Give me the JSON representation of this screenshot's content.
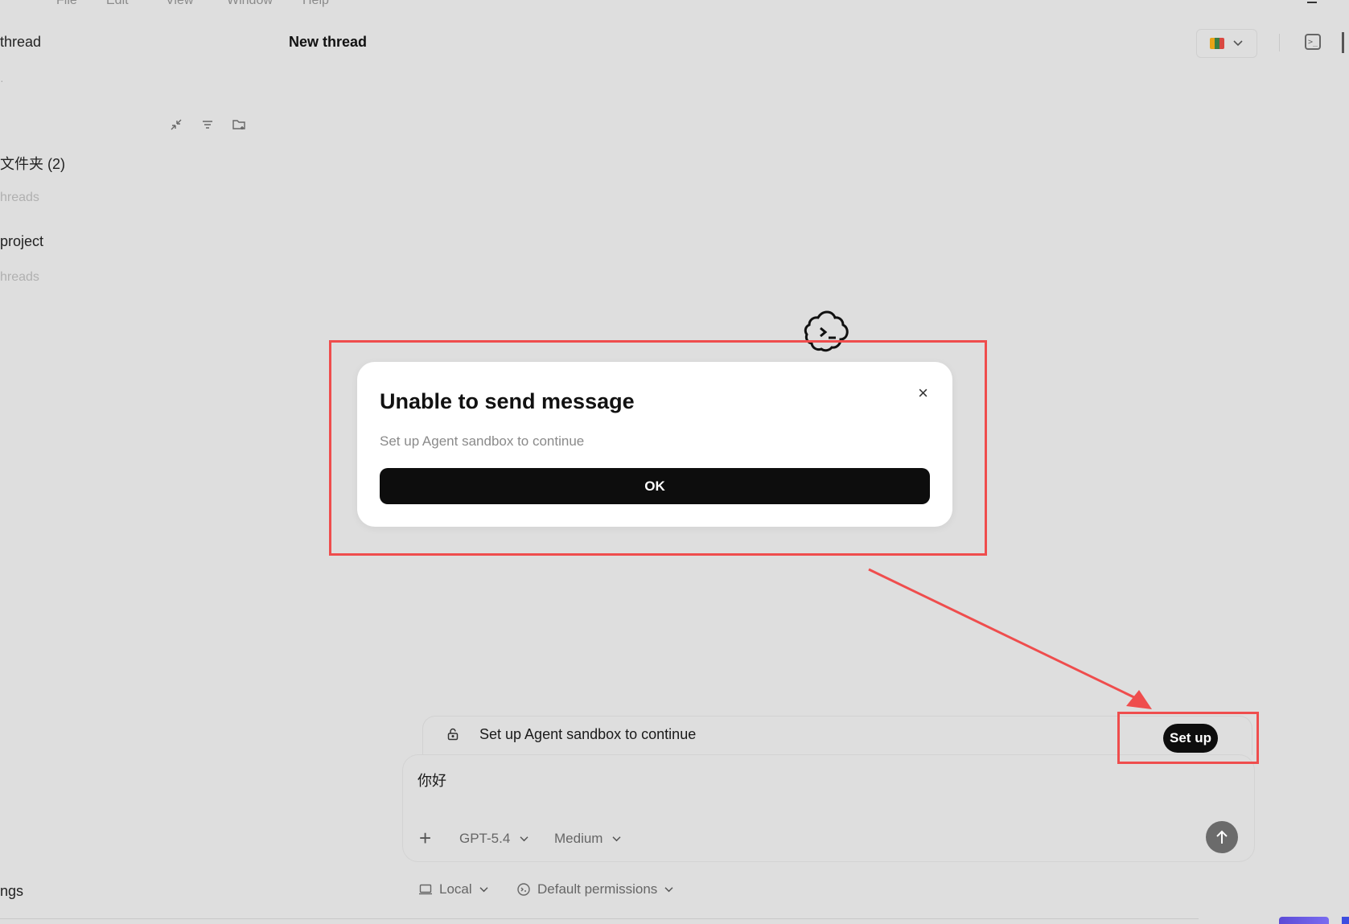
{
  "menubar": {
    "items": [
      "File",
      "Edit",
      "View",
      "Window",
      "Help"
    ]
  },
  "sidebar": {
    "title": "thread",
    "section1": {
      "label": "文件夹 (2)",
      "sub": "hreads"
    },
    "section2": {
      "label": "project",
      "sub": "hreads"
    },
    "settings_label": "ngs"
  },
  "header": {
    "thread_title": "New thread"
  },
  "modal": {
    "title": "Unable to send message",
    "description": "Set up Agent sandbox to continue",
    "ok_label": "OK",
    "close_glyph": "×"
  },
  "banner": {
    "text": "Set up Agent sandbox to continue",
    "setup_label": "Set up"
  },
  "composer": {
    "text": "你好",
    "model_label": "GPT-5.4",
    "effort_label": "Medium"
  },
  "footer": {
    "env_label": "Local",
    "permissions_label": "Default permissions"
  },
  "colors": {
    "background": "#dedede",
    "annotation_red": "#ef4d4d",
    "primary_button": "#0d0d0d"
  }
}
